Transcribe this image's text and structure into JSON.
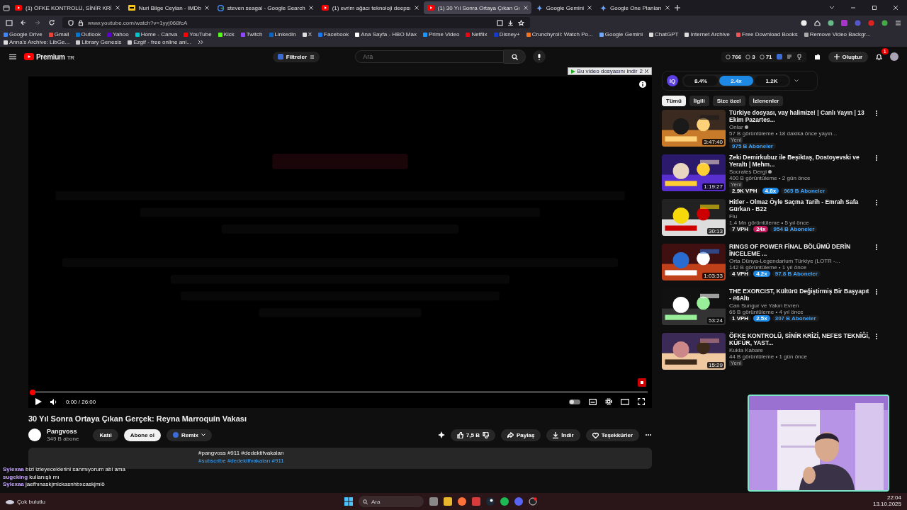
{
  "browser": {
    "tabs": [
      {
        "title": "(1) ÖFKE KONTROLÜ, SİNİR KRİ",
        "kind": "youtube",
        "selected": false
      },
      {
        "title": "Nuri Bilge Ceylan - IMDb",
        "kind": "imdb",
        "selected": false
      },
      {
        "title": "steven seagal - Google Search",
        "kind": "google",
        "selected": false
      },
      {
        "title": "(1) evrim ağacı teknoloji deepsı",
        "kind": "youtube",
        "selected": false
      },
      {
        "title": "(1) 30 Yıl Sonra Ortaya Çıkan Gı",
        "kind": "youtube",
        "selected": true
      },
      {
        "title": "Google Gemini",
        "kind": "gemini",
        "selected": false
      },
      {
        "title": "Google One Planları",
        "kind": "gemini",
        "selected": false
      }
    ],
    "url": "www.youtube.com/watch?v=1yyj068fcA",
    "bookmarks": [
      "Google Drive",
      "Gmail",
      "Outlook",
      "Yahoo",
      "Home - Canva",
      "YouTube",
      "Kick",
      "Twitch",
      "LinkedIn",
      "X",
      "Facebook",
      "Ana Sayfa - HBO Max",
      "Prime Video",
      "Netflix",
      "Disney+",
      "Crunchyroll: Watch Po...",
      "Google Gemini",
      "ChatGPT",
      "Internet Archive",
      "Free Download Books",
      "Remove Video Backgr...",
      "Anna's Archive: LibGe...",
      "Library Genesis",
      "Ezgif - free online ani..."
    ]
  },
  "header": {
    "logo": "Premium",
    "region": "TR",
    "filter": "Filtreler",
    "search_placeholder": "Ara",
    "stats": [
      "766",
      "3",
      "71"
    ],
    "create": "Oluştur",
    "notifications": "1"
  },
  "player": {
    "download_banner": "Bu video dosyasını indir",
    "banner_count": "2",
    "time": "0:00 / 26:00",
    "level": 0
  },
  "info": {
    "title": "30 Yıl Sonra Ortaya Çıkan Gerçek: Reyna Marroquín Vakası",
    "channel": "Pangvoss",
    "subscribers": "349 B abone",
    "join": "Katıl",
    "subscribe": "Abone ol",
    "remix": "Remix",
    "likes": "7,5 B",
    "share": "Paylaş",
    "download": "İndir",
    "thanks": "Teşekkürler",
    "description": [
      "#pangvoss #911 #dedektifvakaları",
      "#subscribe #dedektifvakaları #911"
    ]
  },
  "sidebar": {
    "iq_label": "IQ",
    "metrics": [
      {
        "label": "8.4%",
        "selected": false
      },
      {
        "label": "2.4x",
        "selected": true
      },
      {
        "label": "1.2K",
        "selected": false
      }
    ],
    "chips": [
      {
        "label": "Tümü",
        "selected": true
      },
      {
        "label": "İlgili",
        "selected": false
      },
      {
        "label": "Size özel",
        "selected": false
      },
      {
        "label": "İzlenenler",
        "selected": false
      }
    ],
    "videos": [
      {
        "title": "Türkiye dosyası, vay halimize! | Canlı Yayın | 13 Ekim Pazartes...",
        "channel": "Onlar",
        "verified": true,
        "meta": "57 B görüntüleme • 18 dakika önce yayın...",
        "new": "Yeni",
        "duration": "3:47:40",
        "badges": [
          {
            "text": "975 B Aboneler",
            "kind": "subs"
          }
        ]
      },
      {
        "title": "Zeki Demirkubuz ile Beşiktaş, Dostoyevski ve Yeraltı | Mehm...",
        "channel": "Socrates Dergi",
        "verified": true,
        "meta": "400 B görüntüleme • 2 gün önce",
        "new": "Yeni",
        "duration": "1:19:27",
        "badges": [
          {
            "text": "2.9K VPH",
            "kind": "vph"
          },
          {
            "text": "4.8x",
            "kind": "mult",
            "color": "#1e88e5"
          },
          {
            "text": "965 B Aboneler",
            "kind": "subs"
          }
        ]
      },
      {
        "title": "Hitler - Olmaz Öyle Saçma Tarih - Emrah Safa Gürkan - B22",
        "channel": "Flu",
        "verified": false,
        "meta": "1,4 Mn görüntüleme • 5 yıl önce",
        "duration": "30:13",
        "badges": [
          {
            "text": "7 VPH",
            "kind": "vph"
          },
          {
            "text": "24x",
            "kind": "mult",
            "color": "#c2185b"
          },
          {
            "text": "954 B Aboneler",
            "kind": "subs"
          }
        ]
      },
      {
        "title": "RINGS OF POWER FİNAL BÖLÜMÜ DERİN İNCELEME ...",
        "channel": "Orta Dünya-Legendarium Türkiye (LOTR -...",
        "verified": false,
        "meta": "142 B görüntüleme • 1 yıl önce",
        "duration": "1:03:33",
        "badges": [
          {
            "text": "4 VPH",
            "kind": "vph"
          },
          {
            "text": "4.2x",
            "kind": "mult",
            "color": "#1e88e5"
          },
          {
            "text": "97.8 B Aboneler",
            "kind": "subs"
          }
        ]
      },
      {
        "title": "THE EXORCIST, Kültürü Değiştirmiş Bir Başyapıt - #6Altı",
        "channel": "Can Sungur ve Yakın Evren",
        "verified": false,
        "meta": "66 B görüntüleme • 4 yıl önce",
        "duration": "53:24",
        "badges": [
          {
            "text": "1 VPH",
            "kind": "vph"
          },
          {
            "text": "2.5x",
            "kind": "mult",
            "color": "#1e88e5"
          },
          {
            "text": "307 B Aboneler",
            "kind": "subs"
          }
        ]
      },
      {
        "title": "ÖFKE KONTROLÜ, SİNİR KRİZİ, NEFES TEKNİĞİ, KÜFÜR, YAST...",
        "channel": "Kukla Kabare",
        "verified": false,
        "meta": "44 B görüntüleme • 1 gün önce",
        "new": "Yeni",
        "duration": "15:29"
      }
    ]
  },
  "chat": [
    {
      "user": "Sylexaa",
      "message": "bizi izleyeceklerini sanmıyorum abi ama"
    },
    {
      "user": "sugeking",
      "message": "kullanışlı mı"
    },
    {
      "user": "Sylexaa",
      "message": "jaefhınaskjmlckasnhbxcaskjmlö"
    }
  ],
  "taskbar": {
    "weather": "Çok bulutlu",
    "search_placeholder": "Ara",
    "time": "22:04",
    "date": "13.10.2025"
  }
}
